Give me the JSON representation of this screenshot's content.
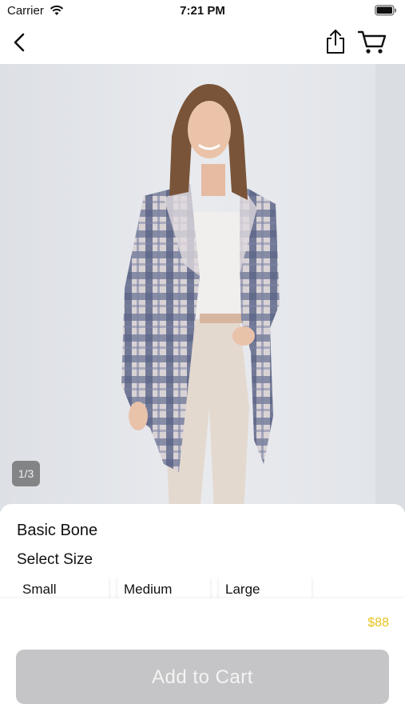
{
  "status_bar": {
    "carrier": "Carrier",
    "time": "7:21 PM"
  },
  "nav": {
    "back_icon": "chevron-left-icon",
    "share_icon": "share-icon",
    "cart_icon": "cart-icon"
  },
  "gallery": {
    "page_indicator": "1/3"
  },
  "product": {
    "name": "Basic Bone",
    "size_label": "Select Size",
    "sizes": [
      "Small",
      "Medium",
      "Large"
    ],
    "price": "$88"
  },
  "cta": {
    "add_to_cart": "Add to Cart"
  },
  "colors": {
    "price": "#e8c31f",
    "button_disabled": "#c5c5c7"
  }
}
